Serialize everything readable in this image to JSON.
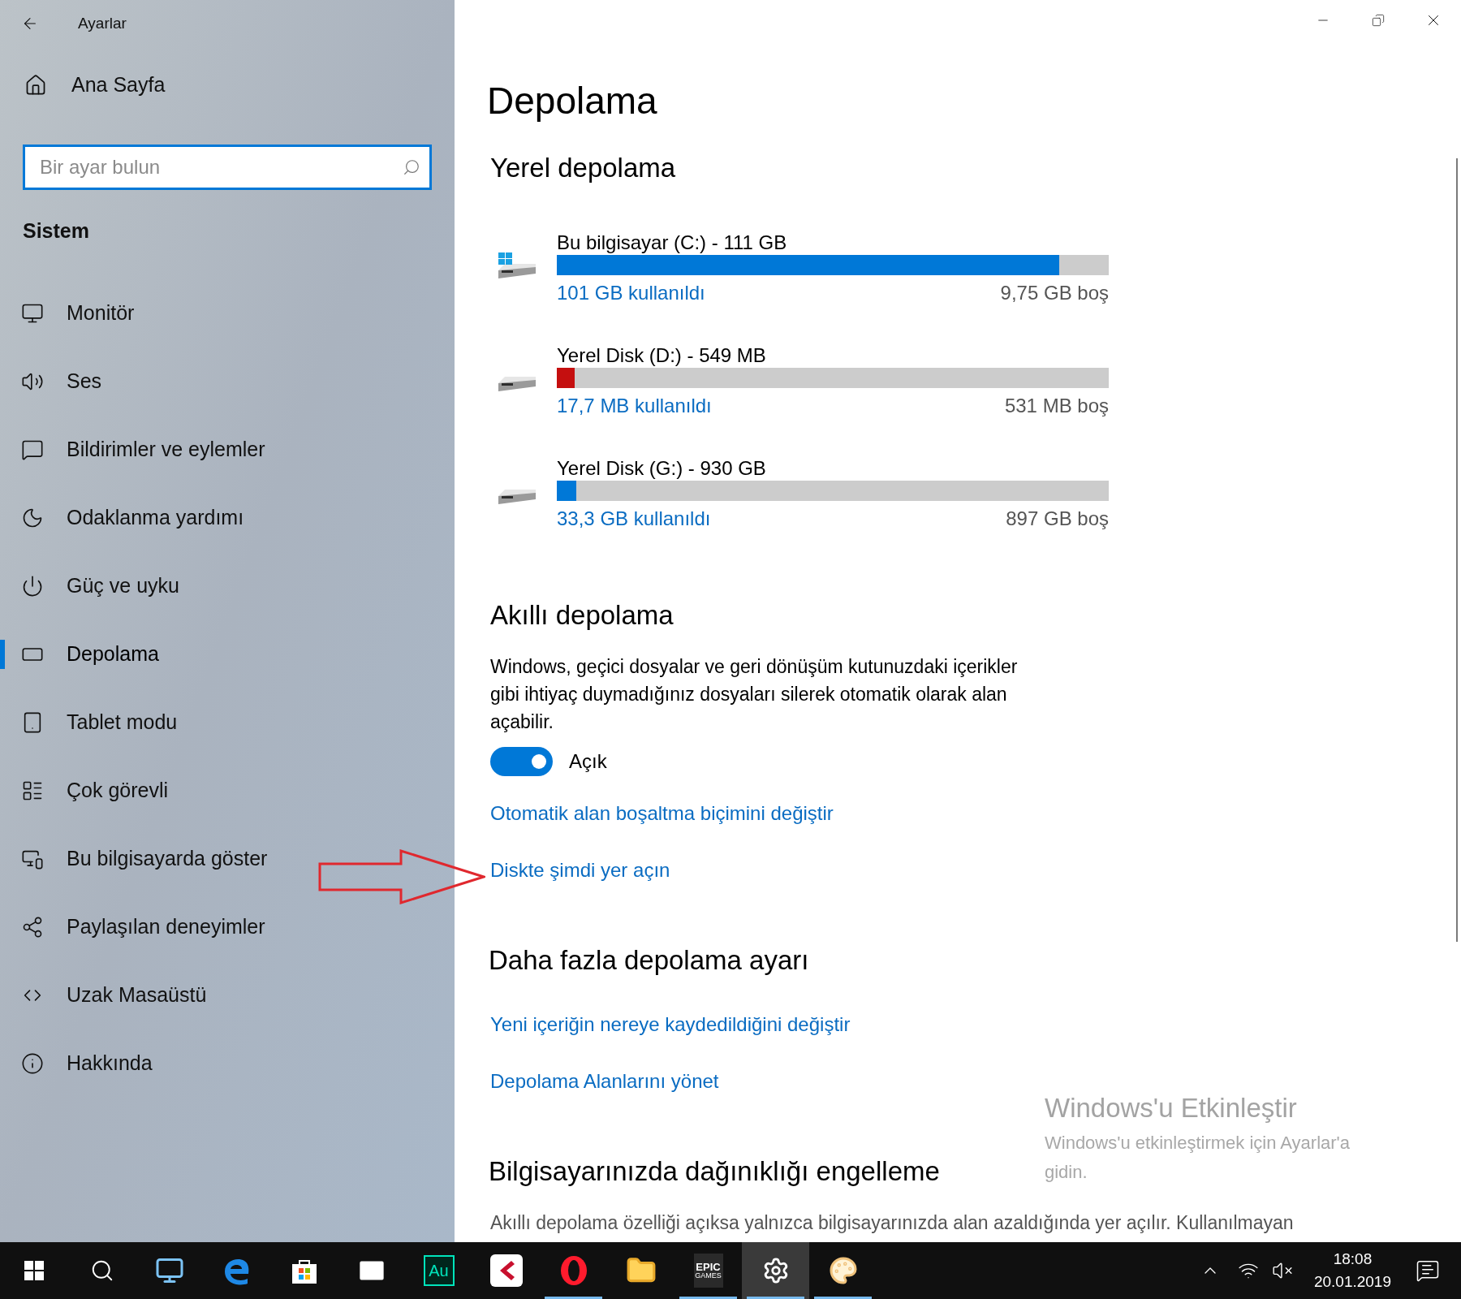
{
  "window": {
    "title": "Ayarlar"
  },
  "sidebar": {
    "home": "Ana Sayfa",
    "search": {
      "placeholder": "Bir ayar bulun"
    },
    "section": "Sistem",
    "items": [
      {
        "label": "Monitör",
        "selected": false
      },
      {
        "label": "Ses",
        "selected": false
      },
      {
        "label": "Bildirimler ve eylemler",
        "selected": false
      },
      {
        "label": "Odaklanma yardımı",
        "selected": false
      },
      {
        "label": "Güç ve uyku",
        "selected": false
      },
      {
        "label": "Depolama",
        "selected": true
      },
      {
        "label": "Tablet modu",
        "selected": false
      },
      {
        "label": "Çok görevli",
        "selected": false
      },
      {
        "label": "Bu bilgisayarda göster",
        "selected": false
      },
      {
        "label": "Paylaşılan deneyimler",
        "selected": false
      },
      {
        "label": "Uzak Masaüstü",
        "selected": false
      },
      {
        "label": "Hakkında",
        "selected": false
      }
    ]
  },
  "page": {
    "title": "Depolama",
    "local_storage": {
      "heading": "Yerel depolama",
      "drives": [
        {
          "kind": "system",
          "name": "Bu bilgisayar (C:) - 111 GB",
          "level": 0.91,
          "color": "#0078d7",
          "used": "101 GB kullanıldı",
          "free": "9,75 GB boş"
        },
        {
          "kind": "data",
          "name": "Yerel Disk (D:) - 549 MB",
          "level": 0.032,
          "color": "#c50f0f",
          "used": "17,7 MB kullanıldı",
          "free": "531 MB boş"
        },
        {
          "kind": "data",
          "name": "Yerel Disk (G:) - 930 GB",
          "level": 0.036,
          "color": "#0078d7",
          "used": "33,3 GB kullanıldı",
          "free": "897 GB boş"
        }
      ]
    },
    "smart_storage": {
      "heading": "Akıllı depolama",
      "description": "Windows, geçici dosyalar ve geri dönüşüm kutunuzdaki içerikler gibi ihtiyaç duymadığınız dosyaları silerek otomatik olarak alan açabilir.",
      "toggle": {
        "on": true,
        "label": "Açık"
      },
      "links": [
        "Otomatik alan boşaltma biçimini değiştir",
        "Diskte şimdi yer açın"
      ]
    },
    "more_settings": {
      "heading": "Daha fazla depolama ayarı",
      "links": [
        "Yeni içeriğin nereye kaydedildiğini değiştir",
        "Depolama Alanlarını yönet"
      ]
    },
    "clutter": {
      "heading": "Bilgisayarınızda dağınıklığı engelleme",
      "description": "Akıllı depolama özelliği açıksa yalnızca bilgisayarınızda alan azaldığında yer açılır. Kullanılmayan"
    }
  },
  "activation": {
    "title": "Windows'u Etkinleştir",
    "text": "Windows'u etkinleştirmek için Ayarlar'a gidin."
  },
  "taskbar": {
    "apps": [
      {
        "kind": "start",
        "running": false,
        "selected": false
      },
      {
        "kind": "search",
        "running": false,
        "selected": false
      },
      {
        "kind": "computer",
        "running": false,
        "selected": false
      },
      {
        "kind": "edge",
        "running": false,
        "selected": false
      },
      {
        "kind": "store",
        "running": false,
        "selected": false
      },
      {
        "kind": "mail",
        "running": false,
        "selected": false
      },
      {
        "kind": "audition",
        "label": "Au",
        "running": false,
        "selected": false
      },
      {
        "kind": "cubase",
        "running": false,
        "selected": false
      },
      {
        "kind": "opera",
        "running": true,
        "selected": false
      },
      {
        "kind": "explorer",
        "running": false,
        "selected": false
      },
      {
        "kind": "epic",
        "label": "EPIC",
        "sublabel": "GAMES",
        "running": true,
        "selected": false
      },
      {
        "kind": "settings",
        "running": true,
        "selected": true
      },
      {
        "kind": "paint",
        "running": true,
        "selected": false
      }
    ],
    "time": "18:08",
    "date": "20.01.2019"
  }
}
